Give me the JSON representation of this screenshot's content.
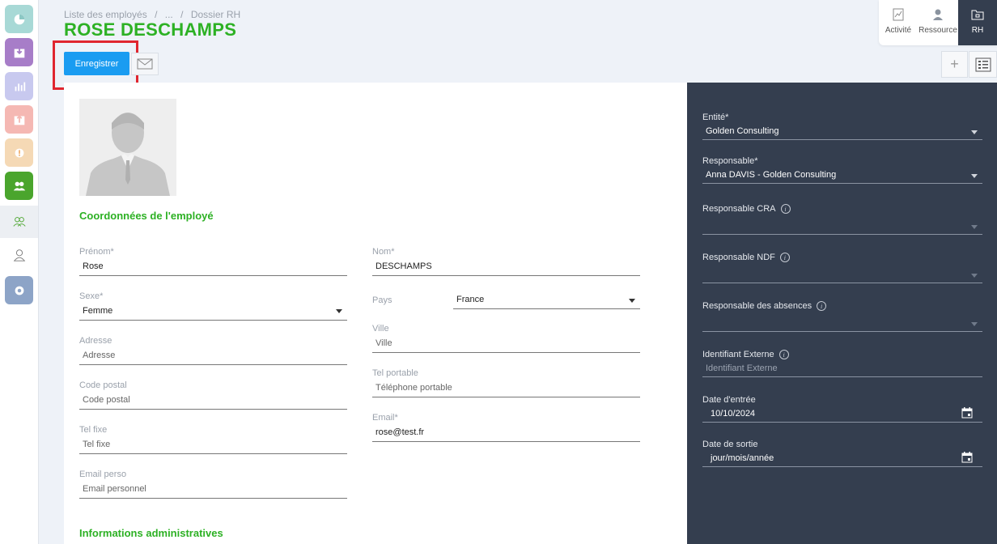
{
  "breadcrumb": [
    "Liste des employés",
    "/",
    "...",
    "/",
    "Dossier RH"
  ],
  "page_title": "ROSE DESCHAMPS",
  "toolbar": {
    "save_label": "Enregistrer"
  },
  "top_tabs": [
    {
      "label": "Activité",
      "icon": "chart-icon"
    },
    {
      "label": "Ressource",
      "icon": "user-icon"
    },
    {
      "label": "RH",
      "icon": "folder-icon"
    }
  ],
  "sections": {
    "coordinates": "Coordonnées de l'employé",
    "admin": "Informations administratives"
  },
  "left_fields": {
    "prenom": {
      "label": "Prénom*",
      "value": "Rose"
    },
    "sexe": {
      "label": "Sexe*",
      "value": "Femme"
    },
    "adresse": {
      "label": "Adresse",
      "placeholder": "Adresse"
    },
    "code_postal": {
      "label": "Code postal",
      "placeholder": "Code postal"
    },
    "tel_fixe": {
      "label": "Tel fixe",
      "placeholder": "Tel fixe"
    },
    "email_perso": {
      "label": "Email perso",
      "placeholder": "Email personnel"
    }
  },
  "mid_fields": {
    "nom": {
      "label": "Nom*",
      "value": "DESCHAMPS"
    },
    "pays": {
      "label": "Pays",
      "value": "France"
    },
    "ville": {
      "label": "Ville",
      "placeholder": "Ville"
    },
    "tel_portable": {
      "label": "Tel portable",
      "placeholder": "Téléphone portable"
    },
    "email": {
      "label": "Email*",
      "value": "rose@test.fr"
    }
  },
  "right_fields": {
    "entite": {
      "label": "Entité*",
      "value": "Golden Consulting"
    },
    "responsable": {
      "label": "Responsable*",
      "value": "Anna DAVIS - Golden Consulting"
    },
    "responsable_cra": {
      "label": "Responsable CRA",
      "value": ""
    },
    "responsable_ndf": {
      "label": "Responsable NDF",
      "value": ""
    },
    "responsable_absences": {
      "label": "Responsable des absences",
      "value": ""
    },
    "identifiant_externe": {
      "label": "Identifiant Externe",
      "placeholder": "Identifiant Externe"
    },
    "date_entree": {
      "label": "Date d'entrée",
      "value": "10/10/2024"
    },
    "date_sortie": {
      "label": "Date de sortie",
      "value": "jour/mois/année"
    }
  },
  "colors": {
    "accent_green": "#2db124",
    "save_blue": "#1a9cf1",
    "dark_panel": "#343e4f",
    "highlight_red": "#e0262f"
  }
}
